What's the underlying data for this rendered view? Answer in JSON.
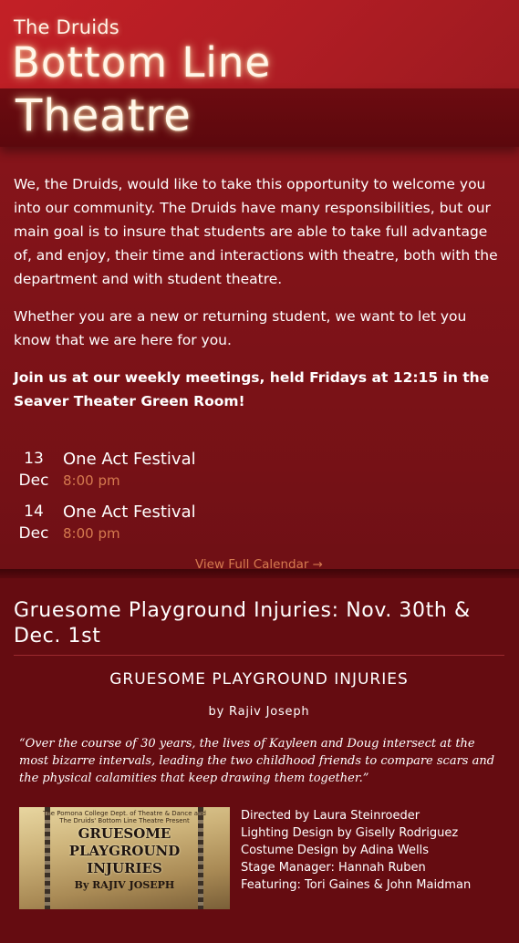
{
  "header": {
    "pre_title": "The Druids",
    "title_line1": "Bottom Line",
    "title_line2": "Theatre"
  },
  "intro": {
    "paragraph1": "We, the Druids, would like to take this opportunity to welcome you into our community. The Druids have many responsibilities, but our main goal is to insure that students are able to take full advantage of, and enjoy, their time and interactions with theatre, both with the department and with student theatre.",
    "paragraph2": "Whether you are a new or returning student, we want to let you know that we are here for you.",
    "paragraph3": "Join us at our weekly meetings, held Fridays at 12:15 in the Seaver Theater Green Room!"
  },
  "events": [
    {
      "day": "13",
      "month": "Dec",
      "title": "One Act Festival",
      "time": "8:00 pm"
    },
    {
      "day": "14",
      "month": "Dec",
      "title": "One Act Festival",
      "time": "8:00 pm"
    }
  ],
  "calendar_link": "View Full Calendar →",
  "article": {
    "heading": "Gruesome Playground Injuries: Nov. 30th & Dec. 1st",
    "show_title": "GRUESOME PLAYGROUND INJURIES",
    "byline": "by Rajiv Joseph",
    "quote": "“Over the course of 30 years, the lives of Kayleen and Doug intersect at the most bizarre intervals, leading the two childhood friends to compare scars and the physical calamities that keep drawing them together.”",
    "poster": {
      "pre_line1": "The Pomona College Dept. of Theatre & Dance and",
      "pre_line2": "The Druids' Bottom Line Theatre Present",
      "title_line1": "GRUESOME",
      "title_line2": "PLAYGROUND",
      "title_line3": "INJURIES",
      "author": "By RAJIV JOSEPH"
    },
    "credits": [
      "Directed by Laura Steinroeder",
      "Lighting Design by Giselly Rodriguez",
      "Costume Design by Adina Wells",
      "Stage Manager: Hannah Ruben",
      "Featuring: Tori Gaines & John Maidman"
    ]
  },
  "colors": {
    "header_red": "#c32026",
    "band_dark": "#5c080d",
    "accent_orange": "#d57a4f"
  }
}
